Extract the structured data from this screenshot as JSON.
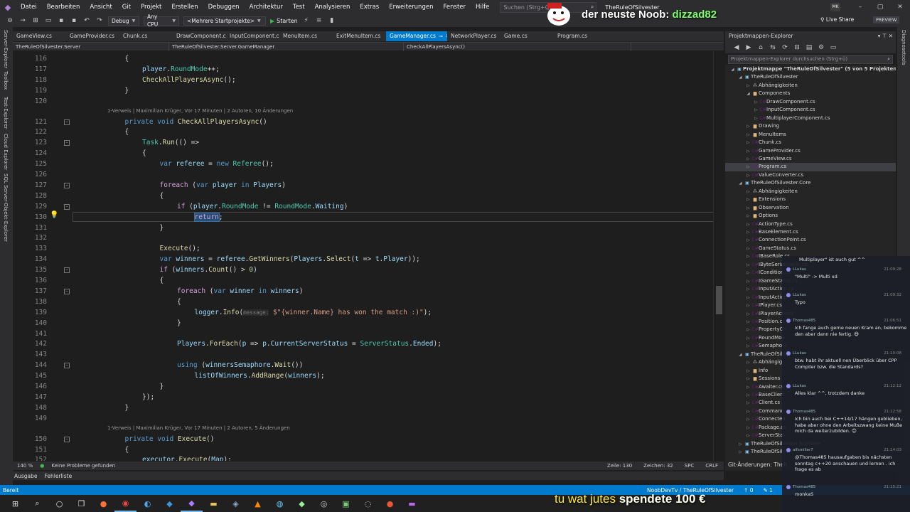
{
  "menubar": {
    "items": [
      "Datei",
      "Bearbeiten",
      "Ansicht",
      "Git",
      "Projekt",
      "Erstellen",
      "Debuggen",
      "Architektur",
      "Test",
      "Analysieren",
      "Extras",
      "Erweiterungen",
      "Fenster",
      "Hilfe"
    ],
    "search_placeholder": "Suchen (Strg+Q)",
    "solution_name": "TheRuleOfSilvester",
    "avatar": "MK"
  },
  "toolbar": {
    "config": "Debug",
    "platform": "Any CPU",
    "startup": "<Mehrere Startprojekte>",
    "start": "Starten",
    "live_share": "Live Share",
    "preview": "PREVIEW"
  },
  "left_strip": [
    "Server-Explorer",
    "Toolbox",
    "Test-Explorer",
    "Cloud Explorer",
    "SQL Server-Objekt-Explorer"
  ],
  "tabs": [
    {
      "label": "GameView.cs",
      "active": false
    },
    {
      "label": "GameProvider.cs",
      "active": false
    },
    {
      "label": "Chunk.cs",
      "active": false
    },
    {
      "label": "DrawComponent.cs",
      "active": false
    },
    {
      "label": "InputComponent.cs",
      "active": false
    },
    {
      "label": "MenuItem.cs",
      "active": false
    },
    {
      "label": "ExitMenuItem.cs",
      "active": false
    },
    {
      "label": "GameManager.cs",
      "active": true
    },
    {
      "label": "NetworkPlayer.cs",
      "active": false
    },
    {
      "label": "Game.cs",
      "active": false
    },
    {
      "label": "Program.cs",
      "active": false
    }
  ],
  "navbar": {
    "project": "TheRuleOfSilvester.Server",
    "class": "TheRuleOfSilvester.Server.GameManager",
    "member": "CheckAllPlayersAsync()"
  },
  "code_lens": [
    "1-Verweis | Maximilian Krüger, Vor 17 Minuten | 2 Autoren, 10 Änderungen",
    "1-Verweis | Maximilian Krüger, Vor 17 Minuten | 2 Autoren, 5 Änderungen"
  ],
  "code": [
    {
      "n": "116",
      "t": "{"
    },
    {
      "n": "117",
      "t": "player.RoundMode++;"
    },
    {
      "n": "118",
      "t": "CheckAllPlayersAsync();"
    },
    {
      "n": "119",
      "t": "}"
    },
    {
      "n": "120",
      "t": ""
    },
    {
      "n": "121",
      "t": "private void CheckAllPlayersAsync()"
    },
    {
      "n": "122",
      "t": "{"
    },
    {
      "n": "123",
      "t": "Task.Run(() =>"
    },
    {
      "n": "124",
      "t": "{"
    },
    {
      "n": "125",
      "t": "var referee = new Referee();"
    },
    {
      "n": "126",
      "t": ""
    },
    {
      "n": "127",
      "t": "foreach (var player in Players)"
    },
    {
      "n": "128",
      "t": "{"
    },
    {
      "n": "129",
      "t": "if (player.RoundMode != RoundMode.Waiting)"
    },
    {
      "n": "130",
      "t": "return;"
    },
    {
      "n": "131",
      "t": "}"
    },
    {
      "n": "132",
      "t": ""
    },
    {
      "n": "133",
      "t": "Execute();"
    },
    {
      "n": "134",
      "t": "var winners = referee.GetWinners(Players.Select(t => t.Player));"
    },
    {
      "n": "135",
      "t": "if (winners.Count() > 0)"
    },
    {
      "n": "136",
      "t": "{"
    },
    {
      "n": "137",
      "t": "foreach (var winner in winners)"
    },
    {
      "n": "138",
      "t": "{"
    },
    {
      "n": "139",
      "t": "logger.Info(message: $\"{winner.Name} has won the match :)\");"
    },
    {
      "n": "140",
      "t": "}"
    },
    {
      "n": "141",
      "t": ""
    },
    {
      "n": "142",
      "t": "Players.ForEach(p => p.CurrentServerStatus = ServerStatus.Ended);"
    },
    {
      "n": "143",
      "t": ""
    },
    {
      "n": "144",
      "t": "using (winnersSemaphore.Wait())"
    },
    {
      "n": "145",
      "t": "listOfWinners.AddRange(winners);"
    },
    {
      "n": "146",
      "t": "}"
    },
    {
      "n": "147",
      "t": "});"
    },
    {
      "n": "148",
      "t": "}"
    },
    {
      "n": "149",
      "t": ""
    },
    {
      "n": "150",
      "t": "private void Execute()"
    },
    {
      "n": "151",
      "t": "{"
    },
    {
      "n": "152",
      "t": "executor.Execute(Map);"
    }
  ],
  "editor_status": {
    "zoom": "140 %",
    "problems": "Keine Probleme gefunden",
    "line": "Zeile: 130",
    "col": "Zeichen: 32",
    "spc": "SPC",
    "crlf": "CRLF"
  },
  "output_tabs": [
    "Ausgabe",
    "Fehlerliste"
  ],
  "statusbar": {
    "ready": "Bereit",
    "repo": "NoobDevTv / TheRuleOfSilvester",
    "up": "0",
    "down": "1"
  },
  "solution_explorer": {
    "title": "Projektmappen-Explorer",
    "search": "Projektmappen-Explorer durchsuchen (Strg+ü)",
    "git_changes": "Git-Änderungen: TheR",
    "nodes": [
      {
        "d": 0,
        "a": "▲",
        "i": "proj",
        "t": "Projektmappe \"TheRuleOfSilvester\" (5 von 5 Projekten)",
        "bold": true
      },
      {
        "d": 1,
        "a": "▲",
        "i": "proj",
        "t": "TheRuleOfSilvester"
      },
      {
        "d": 2,
        "a": "▶",
        "i": "ref",
        "t": "Abhängigkeiten"
      },
      {
        "d": 2,
        "a": "▲",
        "i": "folder",
        "t": "Components"
      },
      {
        "d": 3,
        "a": "▶",
        "i": "cs",
        "t": "DrawComponent.cs"
      },
      {
        "d": 3,
        "a": "▶",
        "i": "cs",
        "t": "InputComponent.cs"
      },
      {
        "d": 3,
        "a": "▶",
        "i": "cs",
        "t": "MultiplayerComponent.cs"
      },
      {
        "d": 2,
        "a": "▶",
        "i": "folder",
        "t": "Drawing"
      },
      {
        "d": 2,
        "a": "▶",
        "i": "folder",
        "t": "MenuItems"
      },
      {
        "d": 2,
        "a": "▶",
        "i": "cs",
        "t": "Chunk.cs"
      },
      {
        "d": 2,
        "a": "▶",
        "i": "cs",
        "t": "GameProvider.cs"
      },
      {
        "d": 2,
        "a": "▶",
        "i": "cs",
        "t": "GameView.cs"
      },
      {
        "d": 2,
        "a": "▶",
        "i": "cs",
        "t": "Program.cs",
        "sel": true
      },
      {
        "d": 2,
        "a": "▶",
        "i": "cs",
        "t": "ValueConverter.cs"
      },
      {
        "d": 1,
        "a": "▲",
        "i": "proj",
        "t": "TheRuleOfSilvester.Core"
      },
      {
        "d": 2,
        "a": "▶",
        "i": "ref",
        "t": "Abhängigkeiten"
      },
      {
        "d": 2,
        "a": "▶",
        "i": "folder",
        "t": "Extensions"
      },
      {
        "d": 2,
        "a": "▶",
        "i": "folder",
        "t": "Observation"
      },
      {
        "d": 2,
        "a": "▶",
        "i": "folder",
        "t": "Options"
      },
      {
        "d": 2,
        "a": "▶",
        "i": "cs",
        "t": "ActionType.cs"
      },
      {
        "d": 2,
        "a": "▶",
        "i": "cs",
        "t": "BaseElement.cs"
      },
      {
        "d": 2,
        "a": "▶",
        "i": "cs",
        "t": "ConnectionPoint.cs"
      },
      {
        "d": 2,
        "a": "▶",
        "i": "cs",
        "t": "GameStatus.cs"
      },
      {
        "d": 2,
        "a": "▶",
        "i": "cs",
        "t": "IBaseRole.cs"
      },
      {
        "d": 2,
        "a": "▶",
        "i": "cs",
        "t": "IByteSerializable.cs"
      },
      {
        "d": 2,
        "a": "▶",
        "i": "cs",
        "t": "ICondition.cs"
      },
      {
        "d": 2,
        "a": "▶",
        "i": "cs",
        "t": "IGameStatus.cs"
      },
      {
        "d": 2,
        "a": "▶",
        "i": "cs",
        "t": "InputAction.cs"
      },
      {
        "d": 2,
        "a": "▶",
        "i": "cs",
        "t": "InputAction"
      },
      {
        "d": 2,
        "a": "▶",
        "i": "cs",
        "t": "IPlayer.cs"
      },
      {
        "d": 2,
        "a": "▶",
        "i": "cs",
        "t": "IPlayerActions"
      },
      {
        "d": 2,
        "a": "▶",
        "i": "cs",
        "t": "Position.cs"
      },
      {
        "d": 2,
        "a": "▶",
        "i": "cs",
        "t": "PropertyCh"
      },
      {
        "d": 2,
        "a": "▶",
        "i": "cs",
        "t": "RoundMod"
      },
      {
        "d": 2,
        "a": "▶",
        "i": "cs",
        "t": "Semaphore"
      },
      {
        "d": 1,
        "a": "▲",
        "i": "proj",
        "t": "TheRuleOfSilve"
      },
      {
        "d": 2,
        "a": "▶",
        "i": "ref",
        "t": "Abhängig"
      },
      {
        "d": 2,
        "a": "▶",
        "i": "folder",
        "t": "Info"
      },
      {
        "d": 2,
        "a": "▶",
        "i": "folder",
        "t": "Sessions"
      },
      {
        "d": 2,
        "a": "▶",
        "i": "cs",
        "t": "Awaiter.cs"
      },
      {
        "d": 2,
        "a": "▶",
        "i": "cs",
        "t": "BaseClient"
      },
      {
        "d": 2,
        "a": "▶",
        "i": "cs",
        "t": "Client.cs"
      },
      {
        "d": 2,
        "a": "▶",
        "i": "cs",
        "t": "Command"
      },
      {
        "d": 2,
        "a": "▶",
        "i": "cs",
        "t": "Connected"
      },
      {
        "d": 2,
        "a": "▶",
        "i": "cs",
        "t": "Package.cs"
      },
      {
        "d": 2,
        "a": "▶",
        "i": "cs",
        "t": "ServerStat"
      },
      {
        "d": 1,
        "a": "▶",
        "i": "proj",
        "t": "TheRuleOfSilvester.Runtime"
      },
      {
        "d": 1,
        "a": "▶",
        "i": "proj",
        "t": "TheRuleOfSilve"
      }
    ]
  },
  "stream": {
    "header_prefix": "der neuste Noob: ",
    "header_user": "dizzad82",
    "donation_name": "tu wat jutes",
    "donation_text": " spendete 100 €",
    "chat": [
      {
        "user": "",
        "time": "",
        "text": "Multiplayer\" ist auch gut ^^"
      },
      {
        "user": "LLukas",
        "time": "21:09:28",
        "text": "\"Multi\" -> Multi xd"
      },
      {
        "user": "LLukas",
        "time": "21:09:32",
        "text": "Typo"
      },
      {
        "user": "Thomas485",
        "time": "21:06:51",
        "text": "Ich fange auch gerne neuen Kram an, bekomme den aber dann nie fertig. 😅"
      },
      {
        "user": "LLukas",
        "time": "21:10:08",
        "text": "btw. habt ihr aktuell nen Überblick über CPP Compiler bzw. die Standards?"
      },
      {
        "user": "LLukas",
        "time": "21:12:12",
        "text": "Alles klar ^^, trotzdem danke"
      },
      {
        "user": "Thomas485",
        "time": "21:12:58",
        "text": "Ich bin auch bei C++14/17 hängen geblieben, habe aber ohne den Arbeitszwang keine Muße mich da weiterzubilden. 😊"
      },
      {
        "user": "alfsmiller7",
        "time": "21:14:03",
        "text": "@Thomas485 hausaufgaben bis nächsten sonntag c++20 anschauen und lernen . ich frage es ab"
      },
      {
        "user": "Thomas485",
        "time": "21:15:21",
        "text": "monkaS"
      }
    ]
  },
  "colors": {
    "accent": "#007acc",
    "editor_bg": "#1e1e1e",
    "chrome": "#2d2d30"
  }
}
